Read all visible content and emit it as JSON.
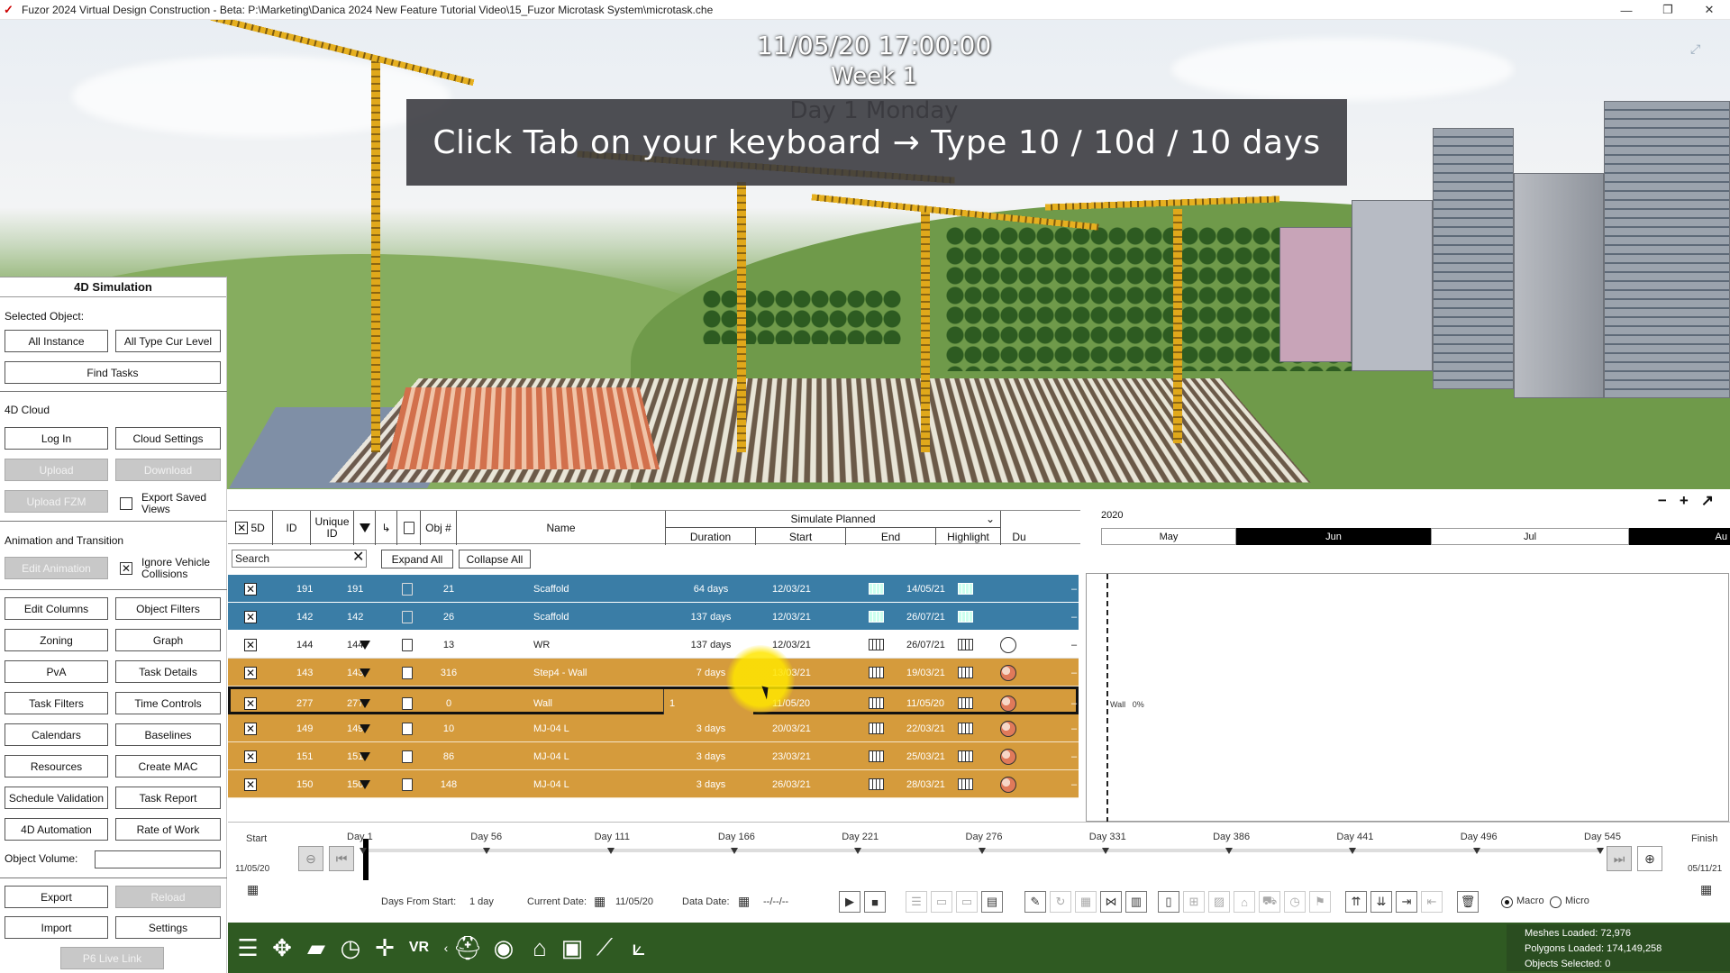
{
  "window": {
    "title": "Fuzor 2024 Virtual Design Construction - Beta: P:\\Marketing\\Danica 2024 New Feature Tutorial Video\\15_Fuzor Microtask System\\microtask.che",
    "minimize": "—",
    "restore": "❐",
    "close": "✕"
  },
  "viewport": {
    "datetime": "11/05/20 17:00:00",
    "week": "Week 1",
    "day": "Day 1 Monday",
    "tip": "Click Tab on your keyboard  → Type 10 / 10d / 10 days"
  },
  "left_panel": {
    "title": "4D Simulation",
    "selected_object_label": "Selected Object:",
    "all_instance": "All Instance",
    "all_type_cur_level": "All Type Cur Level",
    "find_tasks": "Find Tasks",
    "cloud_label": "4D Cloud",
    "log_in": "Log In",
    "cloud_settings": "Cloud Settings",
    "upload": "Upload",
    "download": "Download",
    "upload_fzm": "Upload FZM",
    "export_saved_views": "Export Saved Views",
    "anim_label": "Animation and Transition",
    "edit_animation": "Edit Animation",
    "ignore_vehicle_collisions": "Ignore Vehicle Collisions",
    "edit_columns": "Edit Columns",
    "object_filters": "Object Filters",
    "zoning": "Zoning",
    "graph": "Graph",
    "pva": "PvA",
    "task_details": "Task Details",
    "task_filters": "Task Filters",
    "time_controls": "Time Controls",
    "calendars": "Calendars",
    "baselines": "Baselines",
    "resources": "Resources",
    "create_mac": "Create MAC",
    "schedule_validation": "Schedule Validation",
    "task_report": "Task Report",
    "automation": "4D Automation",
    "rate_of_work": "Rate of Work",
    "object_volume_label": "Object Volume:",
    "export": "Export",
    "reload": "Reload",
    "import": "Import",
    "settings": "Settings",
    "p6_live_link": "P6 Live Link"
  },
  "grid": {
    "headers": {
      "fivd": "5D",
      "id": "ID",
      "unique_id": "Unique ID",
      "obj": "Obj #",
      "name": "Name",
      "simulate": "Simulate Planned",
      "duration": "Duration",
      "start": "Start",
      "end": "End",
      "highlight": "Highlight",
      "du": "Du"
    },
    "search_placeholder": "Search",
    "expand_all": "Expand All",
    "collapse_all": "Collapse All",
    "rows": [
      {
        "id": "191",
        "uid": "191",
        "obj": "21",
        "name": "Scaffold",
        "duration": "64 days",
        "start": "12/03/21",
        "end": "14/05/21",
        "style": "blue",
        "filter": false
      },
      {
        "id": "142",
        "uid": "142",
        "obj": "26",
        "name": "Scaffold",
        "duration": "137 days",
        "start": "12/03/21",
        "end": "26/07/21",
        "style": "blue",
        "filter": false
      },
      {
        "id": "144",
        "uid": "144",
        "obj": "13",
        "name": "WR",
        "duration": "137 days",
        "start": "12/03/21",
        "end": "26/07/21",
        "style": "white",
        "filter": true
      },
      {
        "id": "143",
        "uid": "143",
        "obj": "316",
        "name": "Step4 - Wall",
        "duration": "7 days",
        "start": "13/03/21",
        "end": "19/03/21",
        "style": "orange",
        "filter": true
      },
      {
        "id": "277",
        "uid": "277",
        "obj": "0",
        "name": "Wall",
        "duration": "1",
        "start": "11/05/20",
        "end": "11/05/20",
        "style": "orange selected",
        "filter": true
      },
      {
        "id": "149",
        "uid": "149",
        "obj": "10",
        "name": "MJ-04 L",
        "duration": "3 days",
        "start": "20/03/21",
        "end": "22/03/21",
        "style": "orange",
        "filter": true
      },
      {
        "id": "151",
        "uid": "151",
        "obj": "86",
        "name": "MJ-04 L",
        "duration": "3 days",
        "start": "23/03/21",
        "end": "25/03/21",
        "style": "orange",
        "filter": true
      },
      {
        "id": "150",
        "uid": "150",
        "obj": "148",
        "name": "MJ-04 L",
        "duration": "3 days",
        "start": "26/03/21",
        "end": "28/03/21",
        "style": "orange",
        "filter": true
      }
    ]
  },
  "gantt": {
    "year": "2020",
    "months": [
      "May",
      "Jun",
      "Jul",
      "Au"
    ],
    "bar_label": "Wall",
    "bar_pct": "0%"
  },
  "timeline": {
    "start_label": "Start",
    "finish_label": "Finish",
    "start_date": "11/05/20",
    "finish_date": "05/11/21",
    "days": [
      "Day 1",
      "Day 56",
      "Day 111",
      "Day 166",
      "Day 221",
      "Day 276",
      "Day 331",
      "Day 386",
      "Day 441",
      "Day 496",
      "Day 545"
    ],
    "days_from_start_label": "Days From Start:",
    "days_from_start": "1 day",
    "current_date_label": "Current Date:",
    "current_date": "11/05/20",
    "data_date_label": "Data Date:",
    "data_date": "--/--/--",
    "macro": "Macro",
    "micro": "Micro"
  },
  "stats": {
    "meshes": "Meshes Loaded: 72,976",
    "polygons": "Polygons Loaded: 174,149,258",
    "objects": "Objects Selected: 0"
  }
}
